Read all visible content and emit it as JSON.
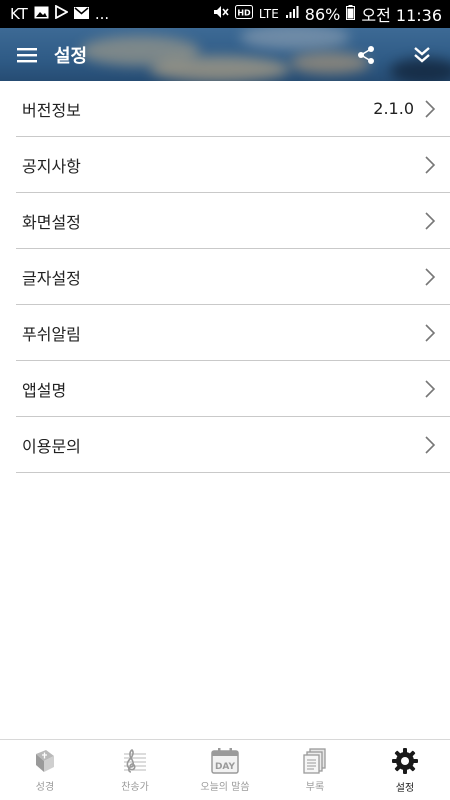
{
  "status_bar": {
    "carrier": "KT",
    "overflow": "...",
    "network": "LTE",
    "battery_percent": "86%",
    "time": "오전 11:36",
    "left_icons": [
      "image-icon",
      "play-store-icon",
      "mail-icon"
    ],
    "right_icons": [
      "mute-icon",
      "hd-icon",
      "signal-icon",
      "battery-icon"
    ]
  },
  "header": {
    "title": "설정",
    "menu_icon": "hamburger-icon",
    "share_icon": "share-icon",
    "collapse_icon": "double-chevron-down-icon"
  },
  "menu": {
    "items": [
      {
        "label": "버전정보",
        "value": "2.1.0"
      },
      {
        "label": "공지사항"
      },
      {
        "label": "화면설정"
      },
      {
        "label": "글자설정"
      },
      {
        "label": "푸쉬알림"
      },
      {
        "label": "앱설명"
      },
      {
        "label": "이용문의"
      }
    ]
  },
  "bottom_nav": {
    "items": [
      {
        "label": "성경",
        "icon": "bible-icon",
        "active": false
      },
      {
        "label": "찬송가",
        "icon": "hymn-icon",
        "active": false
      },
      {
        "label": "오늘의 말씀",
        "icon": "day-calendar-icon",
        "icon_text": "DAY",
        "active": false
      },
      {
        "label": "부록",
        "icon": "documents-icon",
        "active": false
      },
      {
        "label": "설정",
        "icon": "gear-icon",
        "active": true
      }
    ]
  },
  "colors": {
    "header_sky": "#2f5b86",
    "divider": "#c9c9c9",
    "nav_inactive": "#9a9a9a",
    "nav_active": "#222222"
  }
}
